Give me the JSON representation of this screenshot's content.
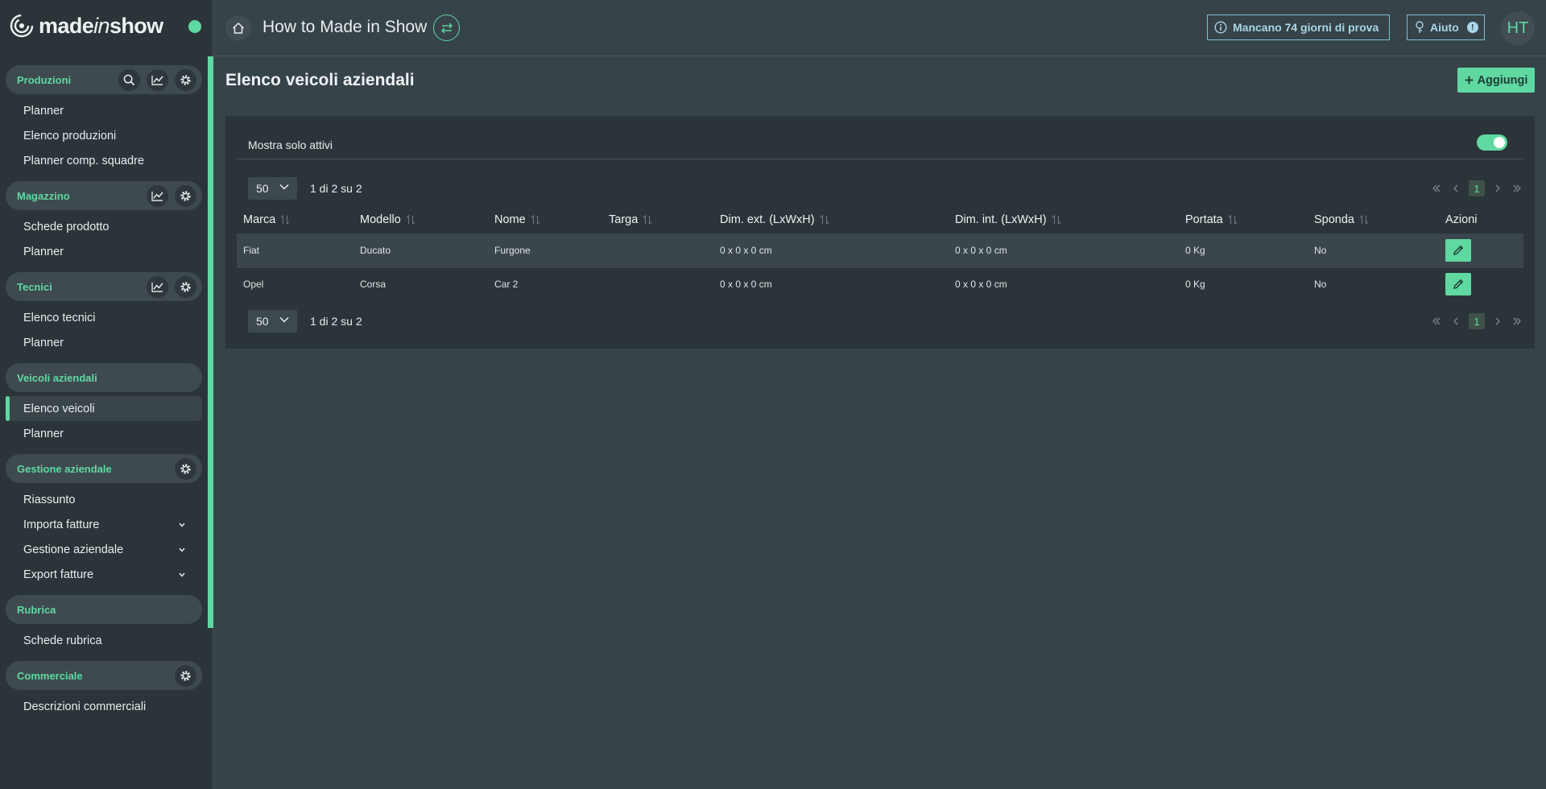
{
  "brand": {
    "logo_text_prefix": "made",
    "logo_text_italic": "in",
    "logo_text_suffix": "show",
    "accent_color": "#5fd8a2"
  },
  "sidebar": {
    "sections": [
      {
        "title": "Produzioni",
        "icons": [
          "search-icon",
          "chart-icon",
          "gear-icon"
        ],
        "items": [
          "Planner",
          "Elenco produzioni",
          "Planner comp. squadre"
        ]
      },
      {
        "title": "Magazzino",
        "icons": [
          "chart-icon",
          "gear-icon"
        ],
        "items": [
          "Schede prodotto",
          "Planner"
        ]
      },
      {
        "title": "Tecnici",
        "icons": [
          "chart-icon",
          "gear-icon"
        ],
        "items": [
          "Elenco tecnici",
          "Planner"
        ]
      },
      {
        "title": "Veicoli aziendali",
        "icons": [],
        "items": [
          "Elenco veicoli",
          "Planner"
        ]
      },
      {
        "title": "Gestione aziendale",
        "icons": [
          "gear-icon"
        ],
        "items": [
          "Riassunto",
          "Importa fatture",
          "Gestione aziendale",
          "Export fatture"
        ]
      },
      {
        "title": "Rubrica",
        "icons": [],
        "items": [
          "Schede rubrica"
        ]
      },
      {
        "title": "Commerciale",
        "icons": [
          "gear-icon"
        ],
        "items": [
          "Descrizioni commerciali"
        ]
      }
    ],
    "active_item": "Elenco veicoli"
  },
  "topbar": {
    "title": "How to Made in Show",
    "trial_text": "Mancano 74 giorni di prova",
    "help_label": "Aiuto",
    "help_badge": "!",
    "avatar_initials": "HT"
  },
  "main": {
    "title": "Elenco veicoli aziendali",
    "add_label": "Aggiungi",
    "filter_label": "Mostra solo attivi",
    "filter_active": true,
    "pager": {
      "per_page": "50",
      "info": "1 di 2 su 2",
      "current_page": "1"
    },
    "table": {
      "columns": [
        "Marca",
        "Modello",
        "Nome",
        "Targa",
        "Dim. ext. (LxWxH)",
        "Dim. int. (LxWxH)",
        "Portata",
        "Sponda",
        "Azioni"
      ],
      "rows": [
        [
          "Fiat",
          "Ducato",
          "Furgone",
          "",
          "0 x 0 x 0 cm",
          "0 x 0 x 0 cm",
          "0 Kg",
          "No"
        ],
        [
          "Opel",
          "Corsa",
          "Car 2",
          "",
          "0 x 0 x 0 cm",
          "0 x 0 x 0 cm",
          "0 Kg",
          "No"
        ]
      ]
    }
  }
}
